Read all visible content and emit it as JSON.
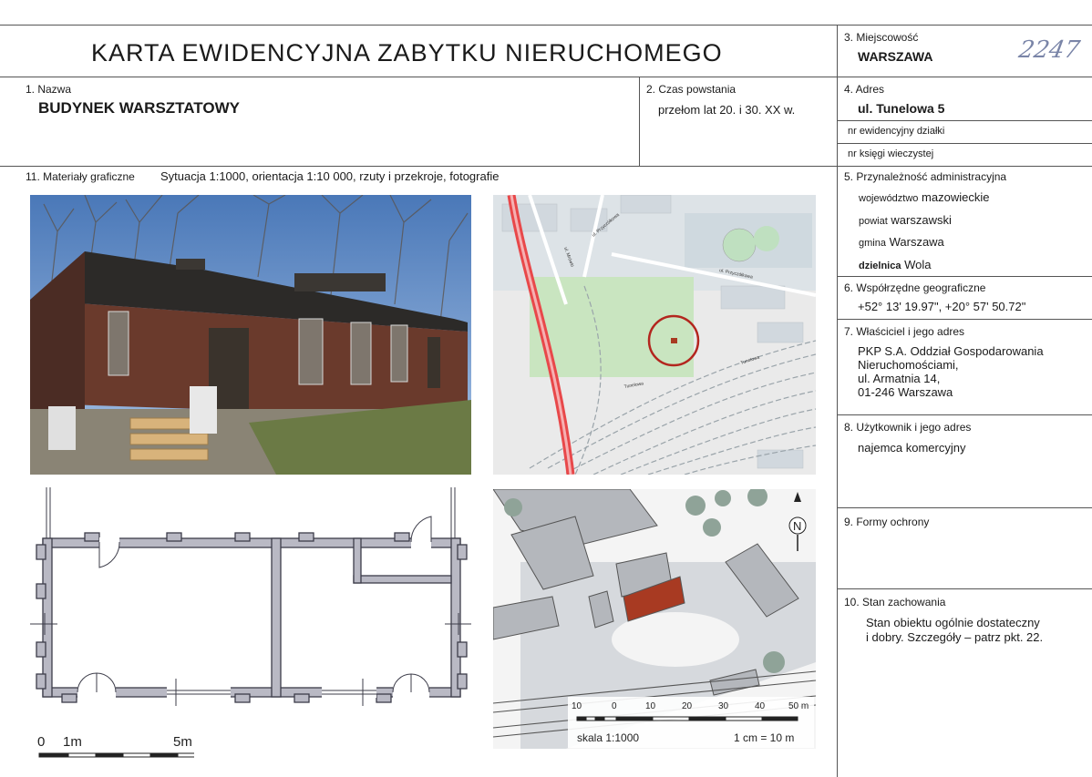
{
  "page_number": "2247",
  "title": "KARTA EWIDENCYJNA ZABYTKU NIERUCHOMEGO",
  "fields": {
    "miejscowosc": {
      "label": "3. Miejscowość",
      "value": "WARSZAWA"
    },
    "nazwa": {
      "label": "1. Nazwa",
      "value": "BUDYNEK WARSZTATOWY"
    },
    "czas": {
      "label": "2. Czas powstania",
      "value": "przełom lat 20. i 30. XX w."
    },
    "adres": {
      "label": "4. Adres",
      "value": "ul. Tunelowa 5",
      "sub1": "nr ewidencyjny działki",
      "sub2": "nr księgi wieczystej"
    },
    "materialy": {
      "label": "11. Materiały graficzne",
      "value": "Sytuacja 1:1000, orientacja 1:10 000, rzuty i przekroje, fotografie"
    },
    "przynaleznosc": {
      "label": "5. Przynależność administracyjna",
      "woj_label": "województwo",
      "woj": "mazowieckie",
      "pow_label": "powiat",
      "pow": "warszawski",
      "gm_label": "gmina",
      "gm": "Warszawa",
      "dz_label": "dzielnica",
      "dz": "Wola"
    },
    "wspolrzedne": {
      "label": "6. Współrzędne geograficzne",
      "value": "+52° 13' 19.97\", +20° 57' 50.72\""
    },
    "wlasciciel": {
      "label": "7. Właściciel i jego adres",
      "lines": [
        "PKP S.A. Oddział Gospodarowania",
        "Nieruchomościami,",
        "ul. Armatnia 14,",
        "01-246 Warszawa"
      ]
    },
    "uzytkownik": {
      "label": "8. Użytkownik i jego adres",
      "value": "najemca komercyjny"
    },
    "formy": {
      "label": "9. Formy ochrony"
    },
    "stan": {
      "label": "10. Stan zachowania",
      "lines": [
        "Stan obiektu ogólnie dostateczny",
        "i dobry. Szczegóły – patrz pkt. 22."
      ]
    }
  },
  "map_labels": {
    "street1": "ul. Przyczółkowa",
    "street2": "ul. Przyczółkowa",
    "street3": "ul. Mrówki",
    "street4": "Tunelowa",
    "street5": "Tunelowa"
  },
  "plan_scale": {
    "zero": "0",
    "one": "1m",
    "five": "5m"
  },
  "site_plan": {
    "north": "N",
    "ticks": [
      "10",
      "0",
      "10",
      "20",
      "30",
      "40",
      "50 m"
    ],
    "scale_text": "skala 1:1000",
    "ratio_text": "1 cm = 10 m"
  },
  "colors": {
    "building": "#a83a22",
    "circle": "#b3261e",
    "rail": "#e8484a"
  }
}
